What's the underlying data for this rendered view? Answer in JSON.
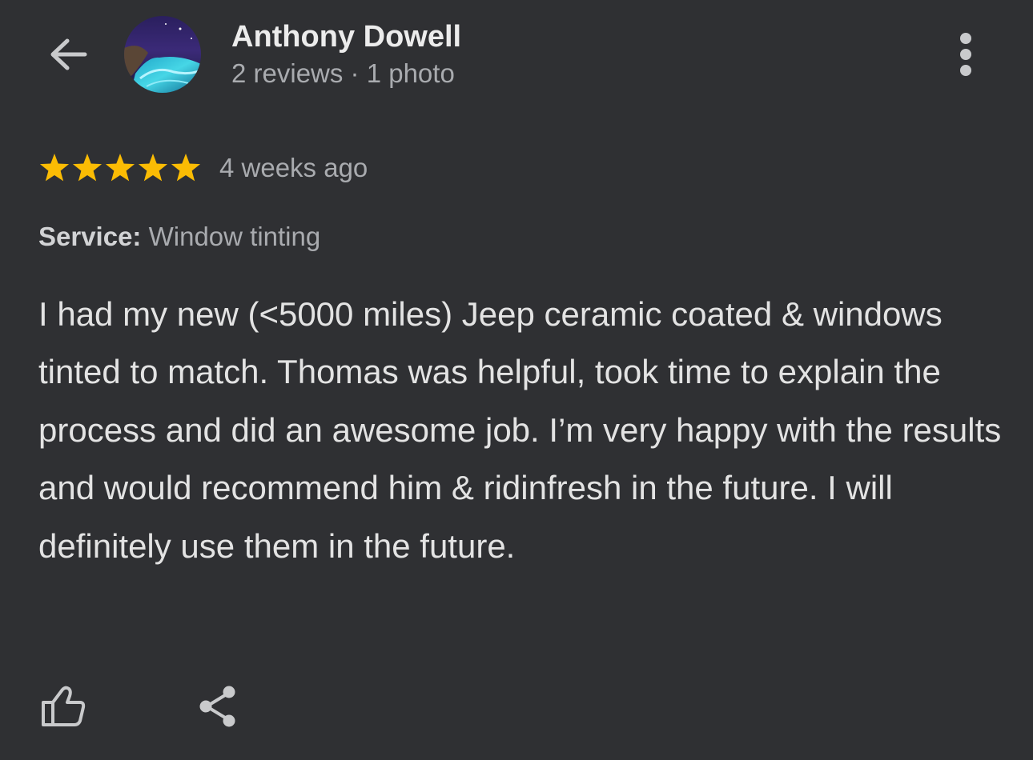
{
  "header": {
    "back_icon": "arrow-left-icon",
    "author_name": "Anthony Dowell",
    "author_meta": "2 reviews · 1 photo",
    "more_icon": "more-vertical-icon"
  },
  "review": {
    "rating": 5,
    "rating_max": 5,
    "star_color": "#fbbc04",
    "date": "4 weeks ago",
    "service_label": "Service:",
    "service_value": "Window tinting",
    "text": "I had my new (<5000 miles) Jeep ceramic coated & windows tinted to match. Thomas was helpful, took time to explain the process and did an awesome job. I’m very happy with the results and would recommend him & ridinfresh in the future. I will definitely use them in the future."
  },
  "actions": {
    "like_icon": "thumbs-up-icon",
    "share_icon": "share-icon"
  },
  "colors": {
    "background": "#2f3033",
    "primary_text": "#e3e3e3",
    "secondary_text": "#a9abaf"
  }
}
